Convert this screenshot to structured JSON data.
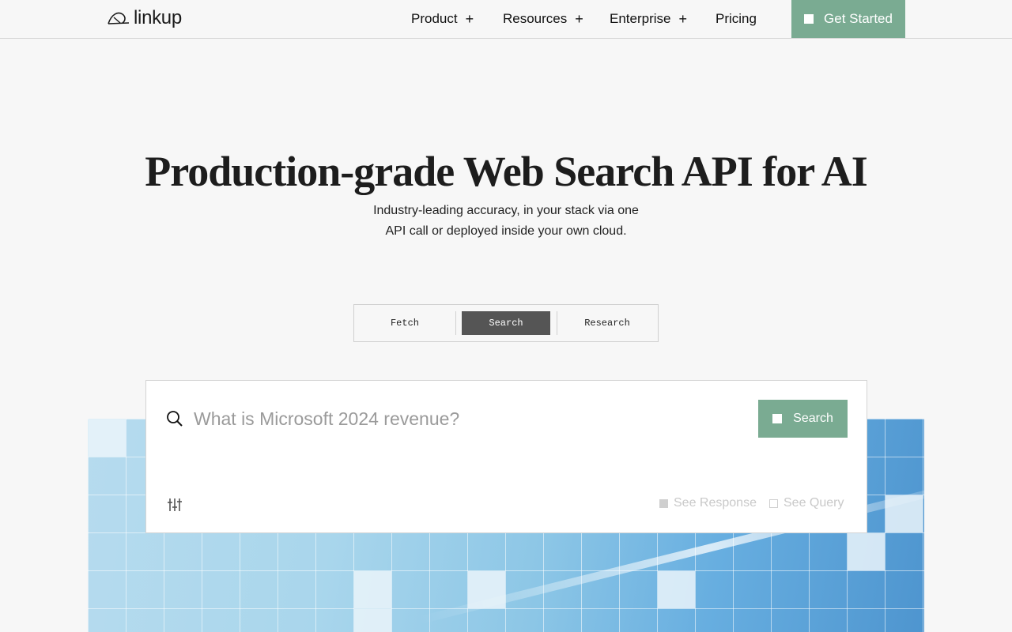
{
  "brand": {
    "name": "linkup"
  },
  "nav": {
    "items": [
      {
        "label": "Product",
        "has_plus": true
      },
      {
        "label": "Resources",
        "has_plus": true
      },
      {
        "label": "Enterprise",
        "has_plus": true
      },
      {
        "label": "Pricing",
        "has_plus": false
      }
    ],
    "plus_symbol": "+",
    "cta_label": "Get Started"
  },
  "hero": {
    "title": "Production-grade Web Search API for AI",
    "subtitle_line1": "Industry-leading accuracy, in your stack via one",
    "subtitle_line2": "API call or deployed inside your own cloud."
  },
  "tabs": {
    "items": [
      "Fetch",
      "Search",
      "Research"
    ],
    "active": "Search"
  },
  "search": {
    "placeholder": "What is Microsoft 2024 revenue?",
    "button_label": "Search",
    "options": [
      {
        "label": "See Response",
        "checked": true
      },
      {
        "label": "See Query",
        "checked": false
      }
    ]
  },
  "colors": {
    "accent": "#7aab92",
    "active_tab": "#555555",
    "background": "#f7f7f7"
  }
}
